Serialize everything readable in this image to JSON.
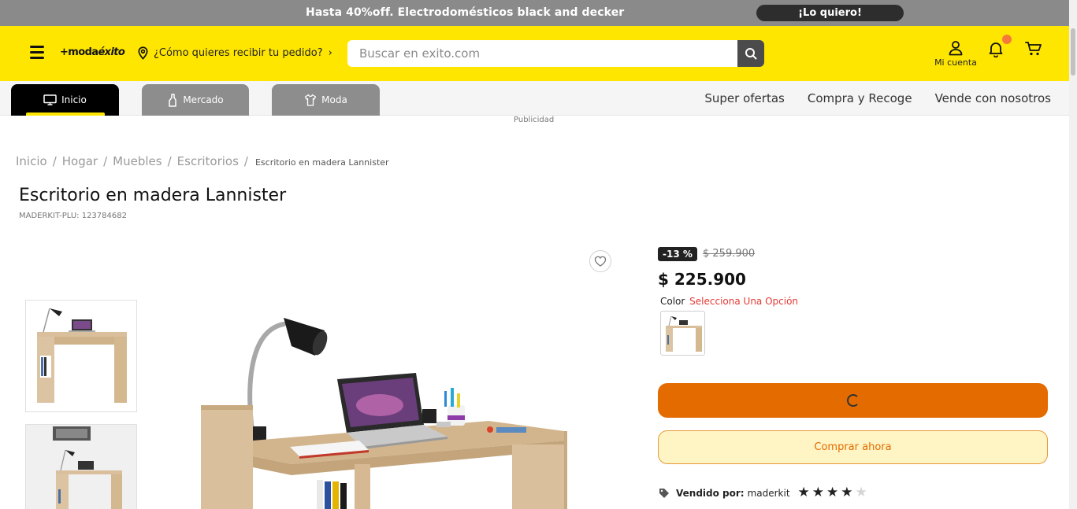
{
  "promo": {
    "text": "Hasta 40%off. Electrodomésticos black and decker",
    "cta": "¡Lo quiero!"
  },
  "header": {
    "logo_prefix": "+",
    "logo_moda": "moda",
    "logo_exito": "éxito",
    "delivery_text": "¿Cómo quieres recibir tu pedido?",
    "delivery_chevron": "›",
    "search_placeholder": "Buscar en exito.com",
    "account_label": "Mi cuenta",
    "colors": {
      "brand_yellow": "#ffe600",
      "notification": "#f4793b"
    }
  },
  "nav": {
    "tabs": [
      {
        "label": "Inicio",
        "icon": "monitor-icon",
        "active": true
      },
      {
        "label": "Mercado",
        "icon": "bottle-icon",
        "active": false
      },
      {
        "label": "Moda",
        "icon": "shirt-icon",
        "active": false
      }
    ],
    "links": [
      "Super ofertas",
      "Compra y Recoge",
      "Vende con nosotros"
    ]
  },
  "publicidad": "Publicidad",
  "breadcrumb": {
    "items": [
      "Inicio",
      "Hogar",
      "Muebles",
      "Escritorios"
    ],
    "separator": "/",
    "current": "Escritorio en madera Lannister"
  },
  "product": {
    "title": "Escritorio en madera Lannister",
    "sku": "MADERKIT-PLU: 123784682",
    "discount": "-13 %",
    "old_price": "$ 259.900",
    "price": "$ 225.900",
    "color_label": "Color",
    "color_select": "Selecciona Una Opción",
    "buy_now": "Comprar ahora",
    "seller_label": "Vendido por:",
    "seller_name": "maderkit",
    "rating": 4,
    "rating_max": 5,
    "colors": {
      "add_button": "#e36b00",
      "buy_bg": "#fff4c4",
      "select_color": "#e53935"
    }
  }
}
